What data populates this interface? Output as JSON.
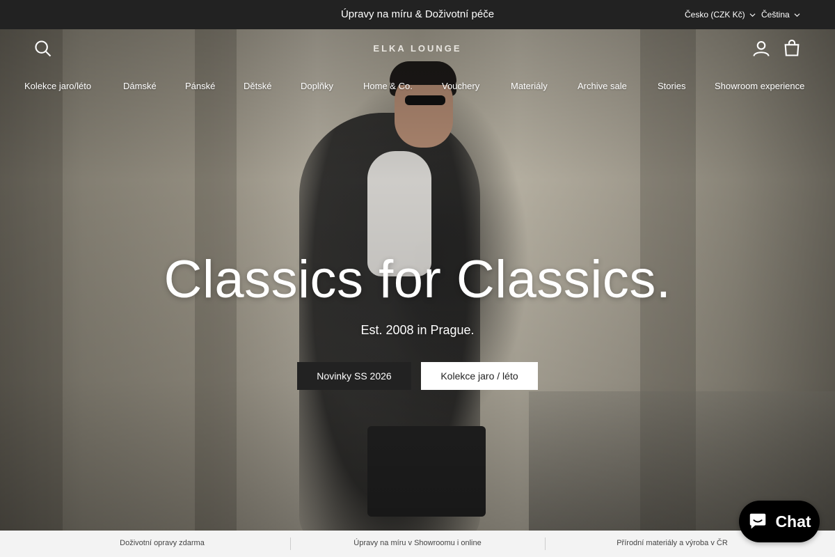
{
  "announcement": {
    "message": "Úpravy na míru & Doživotní péče"
  },
  "locale": {
    "country": "Česko (CZK Kč)",
    "language": "Čeština"
  },
  "header": {
    "logo": "ELKA LOUNGE"
  },
  "nav": {
    "items": [
      {
        "label": "Kolekce jaro/léto"
      },
      {
        "label": "Dámské"
      },
      {
        "label": "Pánské"
      },
      {
        "label": "Dětské"
      },
      {
        "label": "Doplňky"
      },
      {
        "label": "Home & Co."
      },
      {
        "label": "Vouchery"
      },
      {
        "label": "Materiály"
      },
      {
        "label": "Archive sale"
      },
      {
        "label": "Stories"
      },
      {
        "label": "Showroom experience"
      }
    ]
  },
  "hero": {
    "title": "Classics for Classics.",
    "subtitle": "Est. 2008 in Prague.",
    "primary_button": "Novinky SS 2026",
    "secondary_button": "Kolekce jaro / léto"
  },
  "usp": {
    "items": [
      {
        "label": "Doživotní opravy zdarma"
      },
      {
        "label": "Úpravy na míru v Showroomu i online"
      },
      {
        "label": "Přírodní materiály a výroba v ČR"
      }
    ]
  },
  "chat": {
    "label": "Chat"
  },
  "icons": {
    "search": "search-icon",
    "account": "account-icon",
    "cart": "cart-icon",
    "chevron": "chevron-down-icon",
    "chat": "chat-bubble-icon"
  },
  "colors": {
    "announcement_bg": "#222222",
    "dark_button": "#222222",
    "usp_bg": "#f3f3f3",
    "chat_bg": "#000000"
  }
}
